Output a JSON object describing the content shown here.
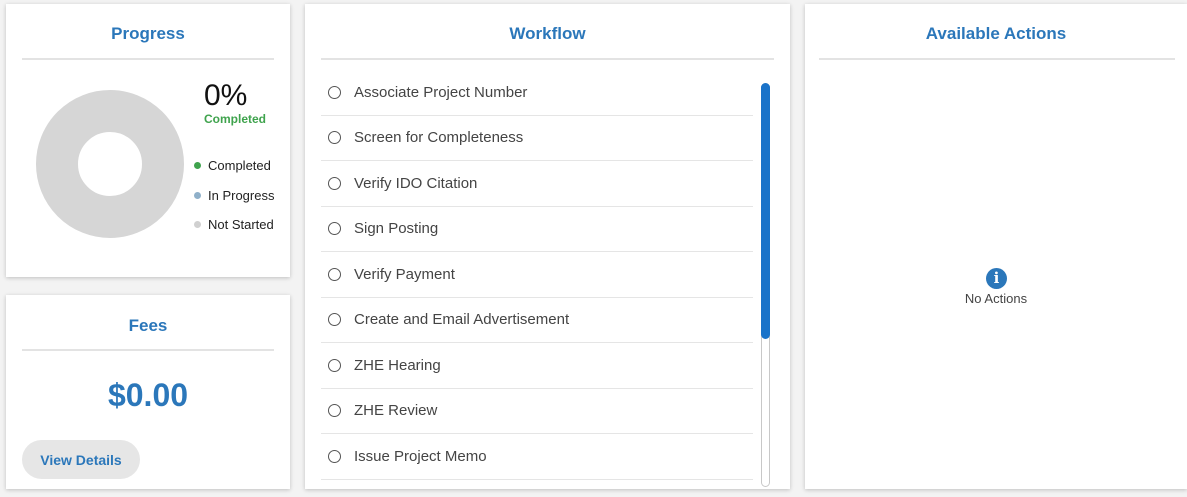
{
  "progress": {
    "title": "Progress",
    "percent": "0%",
    "percent_label": "Completed",
    "legend": [
      {
        "label": "Completed",
        "color": "#3fa34d"
      },
      {
        "label": "In Progress",
        "color": "#8fb0c9"
      },
      {
        "label": "Not Started",
        "color": "#d0d0d0"
      }
    ],
    "donut_color": "#d6d6d6"
  },
  "fees": {
    "title": "Fees",
    "amount": "$0.00",
    "view_details": "View Details"
  },
  "workflow": {
    "title": "Workflow",
    "items": [
      "Associate Project Number",
      "Screen for Completeness",
      "Verify IDO Citation",
      "Sign Posting",
      "Verify Payment",
      "Create and Email Advertisement",
      "ZHE Hearing",
      "ZHE Review",
      "Issue Project Memo"
    ]
  },
  "actions": {
    "title": "Available Actions",
    "info_icon": "i",
    "empty_text": "No Actions"
  },
  "colors": {
    "accent": "#2b77ba",
    "scroll_thumb": "#1a73c9"
  }
}
